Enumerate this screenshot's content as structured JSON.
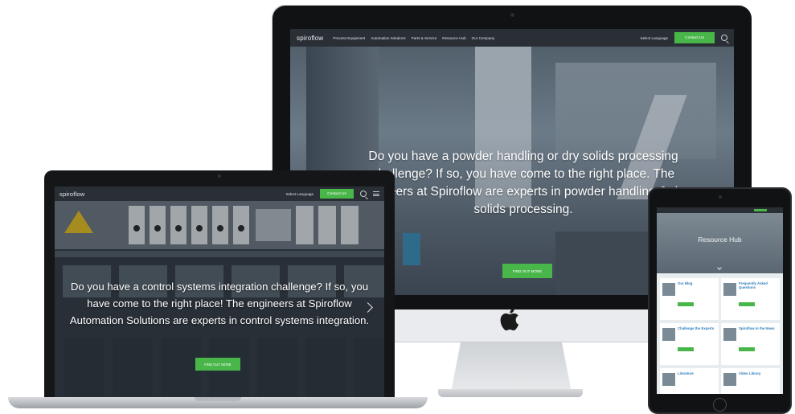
{
  "desktop": {
    "logo": "spiroflow",
    "nav": [
      "Process Equipment",
      "Automation Solutions",
      "Parts & Service",
      "Resource Hub",
      "Our Company"
    ],
    "language": "Select Language",
    "contact": "Contact Us",
    "hero_text": "Do you have a powder handling or dry solids processing challenge? If so, you have come to the right place. The engineers at Spiroflow are experts in powder handling & dry solids processing.",
    "cta": "FIND OUT MORE"
  },
  "laptop": {
    "logo": "spiroflow",
    "language": "Select Language",
    "contact": "Contact Us",
    "hero_text": "Do you have a control systems integration challenge? If so, you have come to the right place! The engineers at Spiroflow Automation Solutions are experts in control systems integration.",
    "cta": "FIND OUT MORE"
  },
  "tablet": {
    "hero_title": "Resource Hub",
    "cards": [
      {
        "title": "Our Blog"
      },
      {
        "title": "Frequently Asked Questions"
      },
      {
        "title": "Challenge the Experts"
      },
      {
        "title": "Spiroflow in the News"
      },
      {
        "title": "Literature"
      },
      {
        "title": "Video Library"
      }
    ]
  },
  "colors": {
    "accent_green": "#49b64a",
    "nav_dark": "#2a2f36",
    "link_blue": "#2b7dbb"
  }
}
